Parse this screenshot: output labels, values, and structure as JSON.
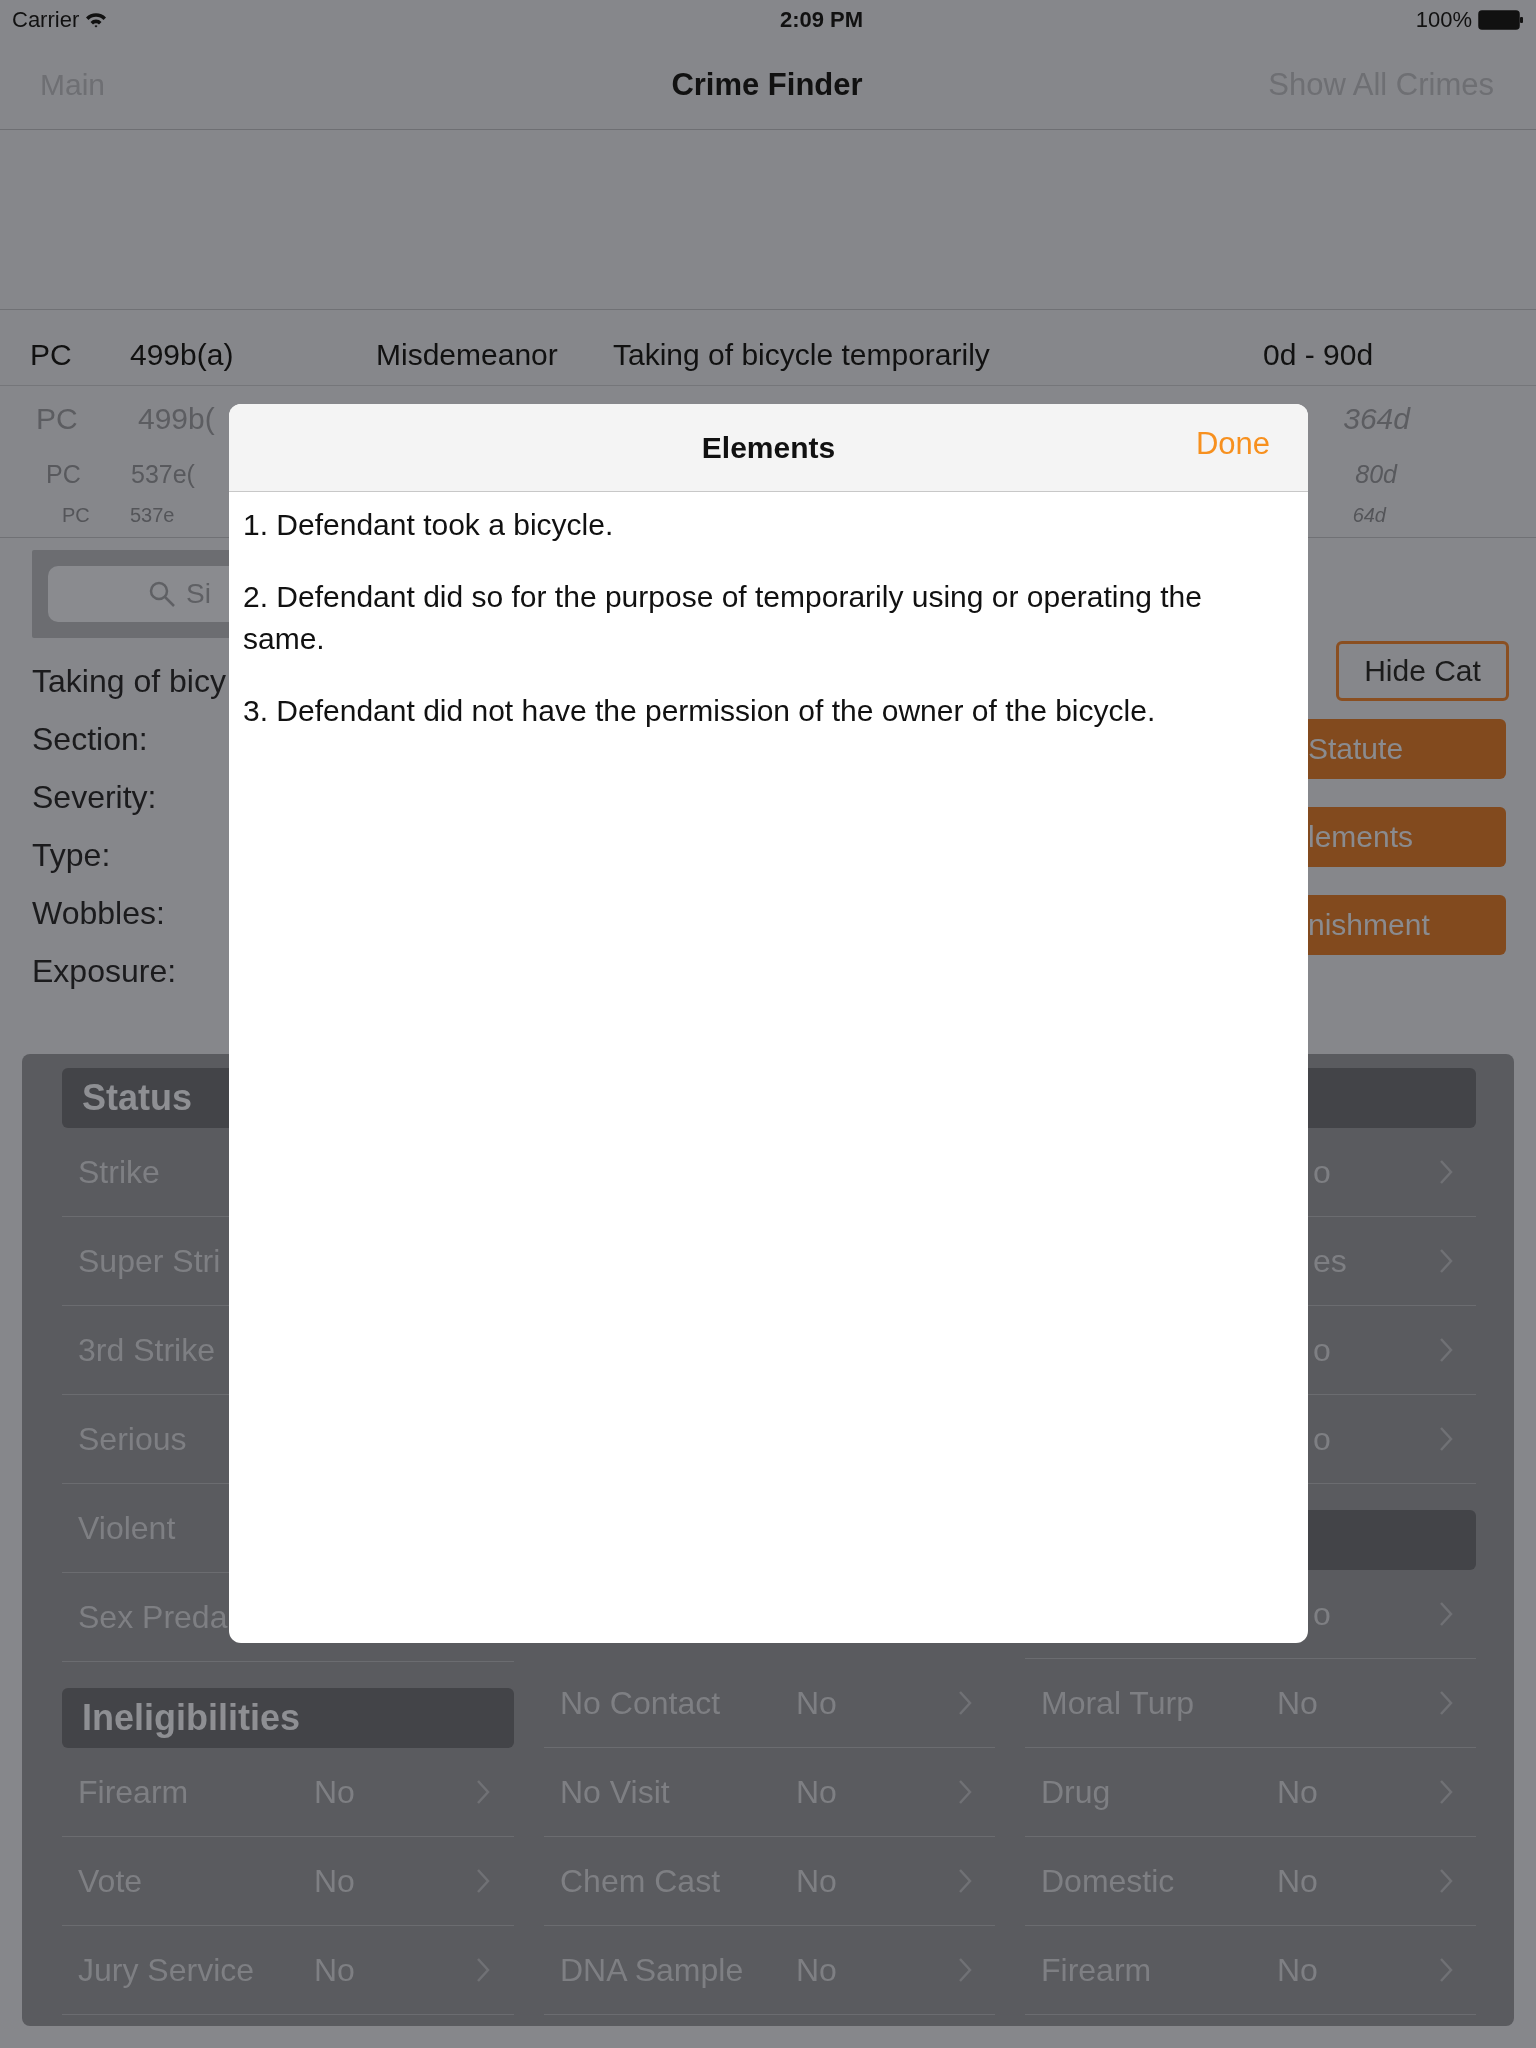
{
  "status_bar": {
    "carrier": "Carrier",
    "time": "2:09 PM",
    "battery": "100%"
  },
  "nav": {
    "left": "Main",
    "title": "Crime Finder",
    "right": "Show All Crimes"
  },
  "results": [
    {
      "selected": true,
      "code": "PC",
      "section": "499b(a)",
      "severity": "Misdemeanor",
      "description": "Taking of bicycle temporarily",
      "range": "0d - 90d"
    },
    {
      "selected": false,
      "code": "PC",
      "section": "499b(",
      "range": "364d"
    },
    {
      "selected": false,
      "code": "PC",
      "section": "537e(",
      "range": "80d"
    },
    {
      "selected": false,
      "code": "PC",
      "section": "537e",
      "range": "64d"
    }
  ],
  "search": {
    "placeholder": "Si"
  },
  "detail": {
    "title": "Taking of bicy",
    "fields": [
      "Section:",
      "Severity:",
      "Type:",
      "Wobbles:",
      "Exposure:"
    ]
  },
  "buttons": [
    {
      "kind": "outline",
      "label": "Hide Cat"
    },
    {
      "kind": "filled",
      "label": "Statute"
    },
    {
      "kind": "filled",
      "label": "lements"
    },
    {
      "kind": "filled",
      "label": "nishment"
    }
  ],
  "panel": {
    "columns": [
      [
        {
          "kind": "header",
          "label": "Status"
        },
        {
          "kind": "row",
          "label": "Strike"
        },
        {
          "kind": "row",
          "label": "Super Stri"
        },
        {
          "kind": "row",
          "label": "3rd Strike"
        },
        {
          "kind": "row",
          "label": "Serious"
        },
        {
          "kind": "row",
          "label": "Violent"
        },
        {
          "kind": "row",
          "label": "Sex Preda"
        },
        {
          "kind": "header",
          "label": "Ineligibilities"
        },
        {
          "kind": "row",
          "label": "Firearm",
          "value": "No"
        },
        {
          "kind": "row",
          "label": "Vote",
          "value": "No"
        },
        {
          "kind": "row",
          "label": "Jury Service",
          "value": "No"
        }
      ],
      [
        {
          "kind": "row",
          "label": "No Contact",
          "value": "No"
        },
        {
          "kind": "row",
          "label": "No Visit",
          "value": "No"
        },
        {
          "kind": "row",
          "label": "Chem Cast",
          "value": "No"
        },
        {
          "kind": "row",
          "label": "DNA Sample",
          "value": "No"
        }
      ],
      [
        {
          "kind": "header"
        },
        {
          "kind": "row",
          "value": "o"
        },
        {
          "kind": "row",
          "value": "es"
        },
        {
          "kind": "row",
          "value": "o"
        },
        {
          "kind": "row",
          "value": "o"
        },
        {
          "kind": "header"
        },
        {
          "kind": "row",
          "value": "o"
        },
        {
          "kind": "row",
          "label": "Moral Turp",
          "value": "No"
        },
        {
          "kind": "row",
          "label": "Drug",
          "value": "No"
        },
        {
          "kind": "row",
          "label": "Domestic",
          "value": "No"
        },
        {
          "kind": "row",
          "label": "Firearm",
          "value": "No"
        }
      ]
    ]
  },
  "modal": {
    "title": "Elements",
    "done": "Done",
    "items": [
      "1. Defendant took a bicycle.",
      "2. Defendant did so for the purpose of temporarily using or operating the same.",
      "3. Defendant did not have the permission of the owner of the bicycle."
    ]
  }
}
